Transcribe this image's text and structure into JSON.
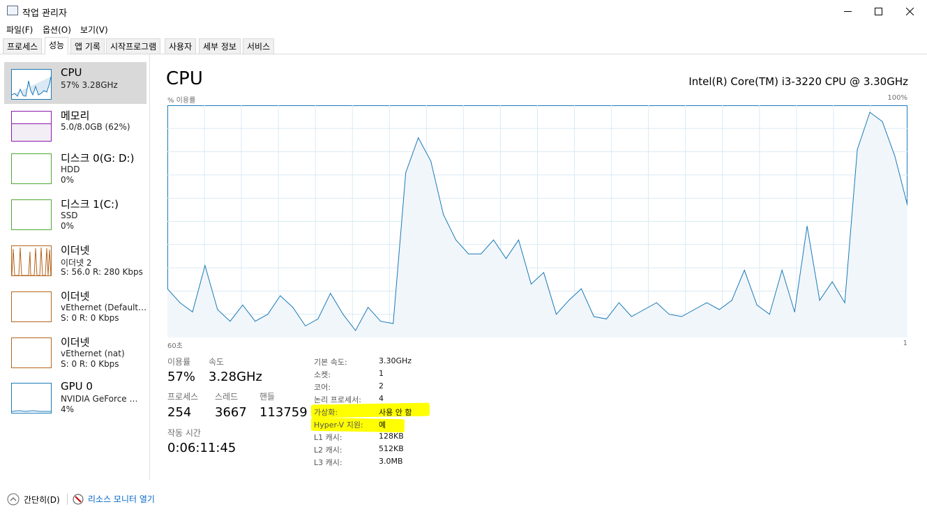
{
  "window": {
    "title": "작업 관리자"
  },
  "menu": [
    "파일(F)",
    "옵션(O)",
    "보기(V)"
  ],
  "tabs": [
    "프로세스",
    "성능",
    "앱 기록",
    "시작프로그램",
    "사용자",
    "세부 정보",
    "서비스"
  ],
  "sidebar": [
    {
      "title": "CPU",
      "sub": "57% 3.28GHz",
      "sub2": "",
      "color": "#1a7ab8"
    },
    {
      "title": "메모리",
      "sub": "5.0/8.0GB (62%)",
      "sub2": "",
      "color": "#8b1aa8"
    },
    {
      "title": "디스크 0(G: D:)",
      "sub": "HDD",
      "sub2": "0%",
      "color": "#4da832"
    },
    {
      "title": "디스크 1(C:)",
      "sub": "SSD",
      "sub2": "0%",
      "color": "#4da832"
    },
    {
      "title": "이더넷",
      "sub": "이더넷 2",
      "sub2": "S: 56.0  R: 280 Kbps",
      "color": "#b5651d"
    },
    {
      "title": "이더넷",
      "sub": "vEthernet (Default…",
      "sub2": "S: 0  R: 0 Kbps",
      "color": "#b5651d"
    },
    {
      "title": "이더넷",
      "sub": "vEthernet (nat)",
      "sub2": "S: 0  R: 0 Kbps",
      "color": "#b5651d"
    },
    {
      "title": "GPU 0",
      "sub": "NVIDIA GeForce …",
      "sub2": "4%",
      "color": "#1a7ab8"
    }
  ],
  "main": {
    "title": "CPU",
    "cpu_name": "Intel(R) Core(TM) i3-3220 CPU @ 3.30GHz",
    "ylabel": "% 이용률",
    "ymax_label": "100%",
    "x_left": "60초",
    "x_right": "1"
  },
  "chart_data": {
    "type": "area",
    "ylabel": "% 이용률",
    "ylim": [
      0,
      100
    ],
    "x_range": [
      "60초",
      "1"
    ],
    "values": [
      21,
      15,
      11,
      31,
      12,
      7,
      14,
      7,
      10,
      18,
      13,
      5,
      8,
      19,
      10,
      3,
      13,
      7,
      6,
      71,
      86,
      76,
      53,
      42,
      36,
      36,
      42,
      34,
      42,
      23,
      28,
      10,
      16,
      21,
      9,
      8,
      15,
      9,
      12,
      15,
      10,
      9,
      12,
      15,
      12,
      16,
      29,
      14,
      10,
      29,
      11,
      48,
      16,
      24,
      15,
      81,
      97,
      93,
      78,
      57
    ],
    "color": "#1a7ab8",
    "fill": "#f1f6fa",
    "grid": true
  },
  "stats": {
    "util_label": "이용률",
    "util_value": "57%",
    "speed_label": "속도",
    "speed_value": "3.28GHz",
    "proc_label": "프로세스",
    "proc_value": "254",
    "thread_label": "스레드",
    "thread_value": "3667",
    "handle_label": "핸들",
    "handle_value": "113759",
    "uptime_label": "작동 시간",
    "uptime_value": "0:06:11:45"
  },
  "info": [
    {
      "label": "기본 속도:",
      "value": "3.30GHz"
    },
    {
      "label": "소켓:",
      "value": "1"
    },
    {
      "label": "코어:",
      "value": "2"
    },
    {
      "label": "논리 프로세서:",
      "value": "4"
    },
    {
      "label": "가상화:",
      "value": "사용 안 함"
    },
    {
      "label": "Hyper-V 지원:",
      "value": "예"
    },
    {
      "label": "L1 캐시:",
      "value": "128KB"
    },
    {
      "label": "L2 캐시:",
      "value": "512KB"
    },
    {
      "label": "L3 캐시:",
      "value": "3.0MB"
    }
  ],
  "footer": {
    "collapse": "간단히(D)",
    "monitor": "리소스 모니터 열기"
  },
  "colors": {
    "link": "#0066cc",
    "highlight": "#ffff00"
  }
}
